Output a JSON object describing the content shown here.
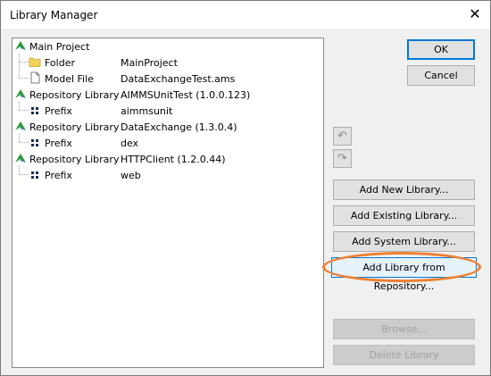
{
  "window": {
    "title": "Library Manager",
    "close_glyph": "✕"
  },
  "tree": {
    "rows": [
      {
        "label": "Main Project",
        "value": "",
        "icon": "aimms-project-icon"
      },
      {
        "label": "Folder",
        "value": "MainProject",
        "icon": "folder-icon"
      },
      {
        "label": "Model File",
        "value": "DataExchangeTest.ams",
        "icon": "file-icon"
      },
      {
        "label": "Repository Library",
        "value": "AIMMSUnitTest (1.0.0.123)",
        "icon": "library-icon"
      },
      {
        "label": "Prefix",
        "value": "aimmsunit",
        "icon": "prefix-icon"
      },
      {
        "label": "Repository Library",
        "value": "DataExchange (1.3.0.4)",
        "icon": "library-icon"
      },
      {
        "label": "Prefix",
        "value": "dex",
        "icon": "prefix-icon"
      },
      {
        "label": "Repository Library",
        "value": "HTTPClient (1.2.0.44)",
        "icon": "library-icon"
      },
      {
        "label": "Prefix",
        "value": "web",
        "icon": "prefix-icon"
      }
    ]
  },
  "buttons": {
    "ok": "OK",
    "cancel": "Cancel",
    "undo_glyph": "↶",
    "redo_glyph": "↷",
    "add_new": "Add New Library...",
    "add_existing": "Add Existing Library...",
    "add_system": "Add System Library...",
    "add_repository": "Add Library from Repository...",
    "browse": "Browse...",
    "delete": "Delete Library"
  },
  "colors": {
    "highlight": "#f08030",
    "focus_blue": "#0078d7",
    "aimms_green": "#2e9a3a"
  }
}
